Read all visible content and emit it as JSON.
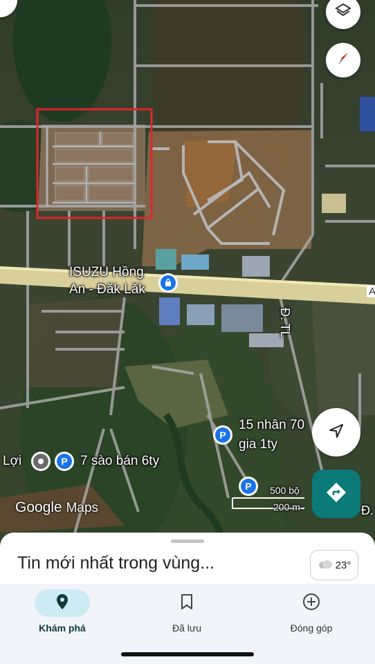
{
  "map": {
    "brand": {
      "google": "Google",
      "maps": "Maps"
    },
    "scale": {
      "imperial": "500 bộ",
      "metric": "200 m"
    },
    "road_labels": {
      "tl": "Đ. TL",
      "edge_a": "A",
      "edge_d": "Đ."
    },
    "places": [
      {
        "name_line1": "ISUZU Hồng",
        "name_line2": "An - Đăk Lăk",
        "icon": "shopping-bag-icon",
        "color": "#1a73e8"
      },
      {
        "name_line1": "15 nhân 70",
        "name_line2": "gia 1ty",
        "icon": "parking-icon",
        "color": "#1a73e8"
      },
      {
        "name": "7 sào bán 6ty",
        "icon": "parking-icon",
        "color": "#1a73e8"
      },
      {
        "name": "Lợi",
        "icon": "place-icon",
        "color": "#6b6b6b"
      }
    ],
    "highlight_color": "#e0262c"
  },
  "controls": {
    "layers_icon": "layers-icon",
    "compass_icon": "compass-icon",
    "location_icon": "my-location-icon",
    "directions_icon": "directions-icon",
    "directions_color": "#0b7a78"
  },
  "sheet": {
    "title": "Tin mới nhất trong vùng...",
    "weather": {
      "temp": "23°",
      "icon": "cloud-icon"
    }
  },
  "bottom_nav": [
    {
      "label": "Khám phá",
      "icon": "place-pin-icon",
      "active": true
    },
    {
      "label": "Đã lưu",
      "icon": "bookmark-icon",
      "active": false
    },
    {
      "label": "Đóng góp",
      "icon": "add-circle-icon",
      "active": false
    }
  ]
}
